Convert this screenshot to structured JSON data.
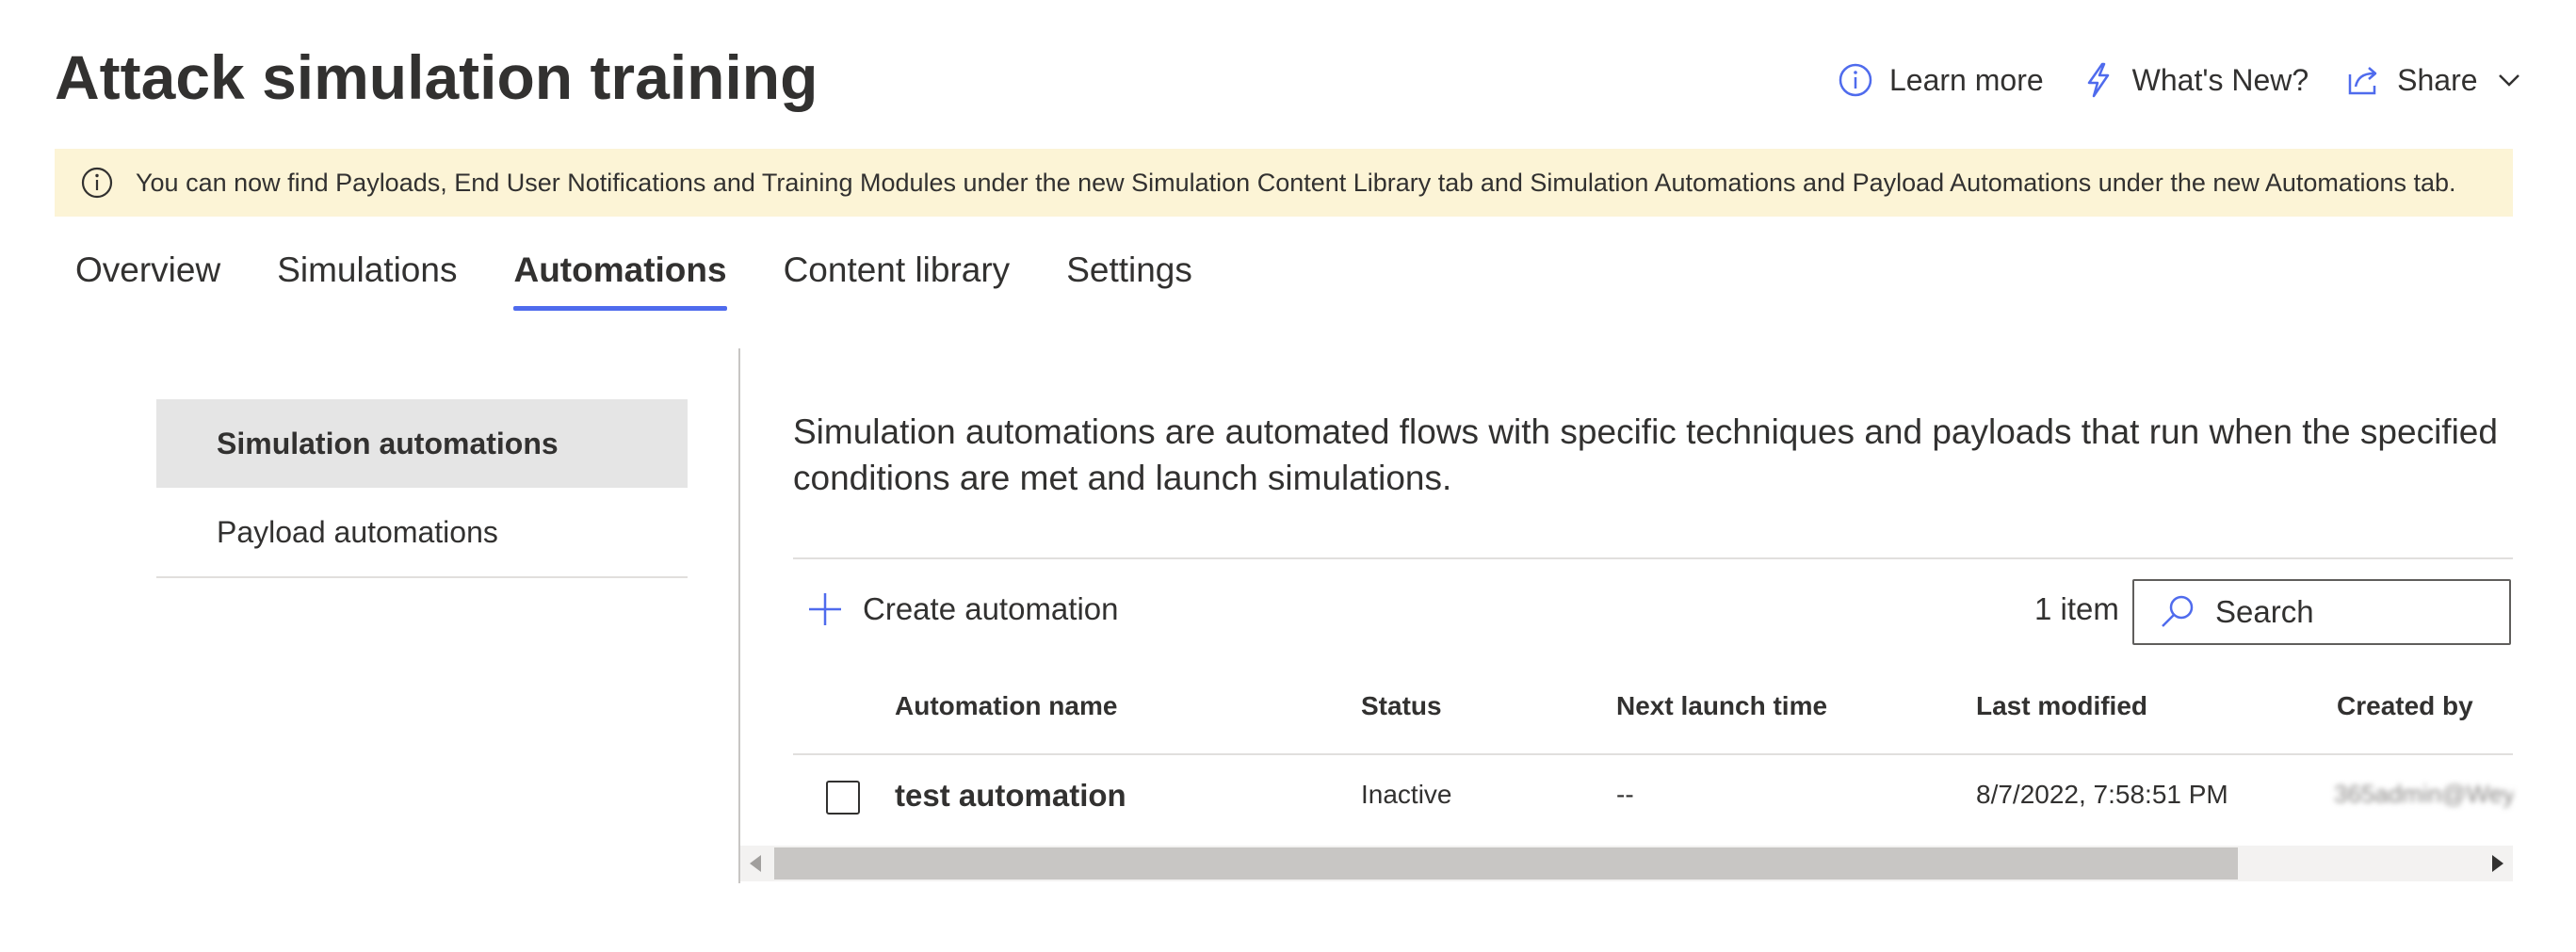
{
  "page": {
    "title": "Attack simulation training"
  },
  "header_actions": {
    "learn_more": "Learn more",
    "whats_new": "What's New?",
    "share": "Share"
  },
  "banner": {
    "text": "You can now find Payloads, End User Notifications and Training Modules under the new Simulation Content Library tab and Simulation Automations and Payload Automations under the new Automations tab."
  },
  "tabs": [
    {
      "label": "Overview",
      "active": false
    },
    {
      "label": "Simulations",
      "active": false
    },
    {
      "label": "Automations",
      "active": true
    },
    {
      "label": "Content library",
      "active": false
    },
    {
      "label": "Settings",
      "active": false
    }
  ],
  "subnav": {
    "items": [
      {
        "label": "Simulation automations",
        "selected": true
      },
      {
        "label": "Payload automations",
        "selected": false
      }
    ]
  },
  "main": {
    "description": "Simulation automations are automated flows with specific techniques and payloads that run when the specified conditions are met and launch simulations.",
    "create_label": "Create automation",
    "item_count": "1 item",
    "search_placeholder": "Search"
  },
  "table": {
    "columns": [
      "Automation name",
      "Status",
      "Next launch time",
      "Last modified",
      "Created by"
    ],
    "rows": [
      {
        "name": "test automation",
        "status": "Inactive",
        "next_launch": "--",
        "last_modified": "8/7/2022, 7:58:51 PM",
        "created_by": "365admin@Wey"
      }
    ]
  },
  "icons": {
    "learn_more": "info-icon",
    "whats_new": "lightning-icon",
    "share": "share-icon",
    "banner": "info-icon",
    "create": "plus-icon",
    "search": "search-icon"
  },
  "colors": {
    "accent": "#4f6bed",
    "banner_bg": "#fcf4d6",
    "selected_bg": "#e5e5e5"
  }
}
